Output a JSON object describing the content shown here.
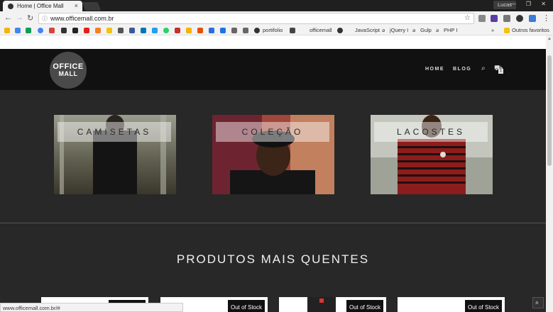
{
  "browser": {
    "tab_title": "Home | Office Mall",
    "tab_close": "×",
    "user": "Lucas",
    "window_controls": "—  ❐  ✕",
    "url": "www.officemall.com.br",
    "status_url": "www.officemall.com.br/#"
  },
  "bookmarks": {
    "items": [
      "portifolio",
      "officemall",
      "JavaScript",
      "jQuery I",
      "Gulp",
      "PHP I"
    ],
    "overflow": "»",
    "other": "Outros favoritos"
  },
  "header": {
    "logo_line1": "OFFICE",
    "logo_line2": "MALL",
    "nav": [
      "HOME",
      "BLOG"
    ],
    "cart_count": "1"
  },
  "categories": [
    {
      "label": "CAMISETAS",
      "color_a": "#8a8d7f",
      "color_b": "#4b4a3e"
    },
    {
      "label": "COLEÇÃO",
      "color_a": "#7b2b2e",
      "color_b": "#b76a52"
    },
    {
      "label": "LACOSTES",
      "color_a": "#bfc2b8",
      "color_b": "#8a1f1f"
    }
  ],
  "section": {
    "title": "PRODUTOS MAIS QUENTES"
  },
  "products": [
    {
      "badge": ""
    },
    {
      "badge": "Out of Stock"
    },
    {
      "badge": "Out of Stock"
    },
    {
      "badge": "Out of Stock"
    }
  ],
  "icons": {
    "back": "back-arrow-icon",
    "forward": "forward-arrow-icon",
    "reload": "reload-icon",
    "search": "search-icon",
    "cart": "cart-icon",
    "to_top": "chevron-up-icon"
  }
}
